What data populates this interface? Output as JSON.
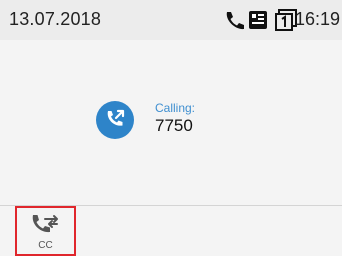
{
  "status_bar": {
    "date": "13.07.2018",
    "time": "16:19",
    "icons": [
      "handset-icon",
      "contact-card-icon",
      "calendar-icon"
    ]
  },
  "call": {
    "status_label": "Calling:",
    "number": "7750",
    "icon": "outgoing-call-icon",
    "accent_color": "#2e84c9"
  },
  "softkeys": [
    {
      "label": "CC",
      "icon": "call-transfer-icon",
      "highlight_color": "#e0262c"
    }
  ]
}
